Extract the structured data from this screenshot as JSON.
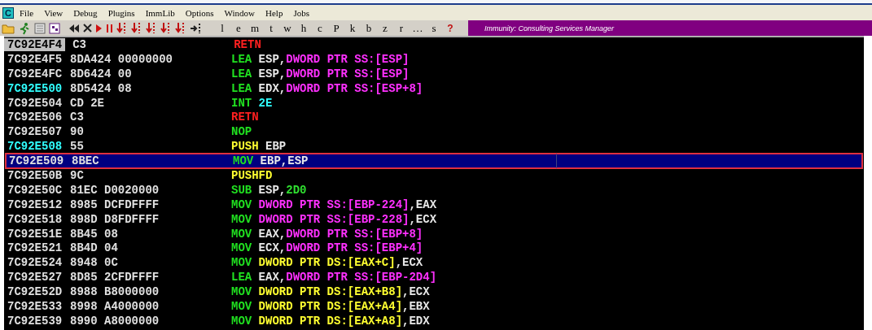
{
  "menu": {
    "app_icon": "C",
    "items": [
      "File",
      "View",
      "Debug",
      "Plugins",
      "ImmLib",
      "Options",
      "Window",
      "Help",
      "Jobs"
    ]
  },
  "toolbar": {
    "buttons": [
      {
        "kind": "open"
      },
      {
        "kind": "run-figure"
      },
      {
        "kind": "window"
      },
      {
        "kind": "threads"
      },
      {
        "kind": "rewind"
      },
      {
        "kind": "close"
      },
      {
        "kind": "play"
      },
      {
        "kind": "pause"
      },
      {
        "kind": "step-into"
      },
      {
        "kind": "step-over"
      },
      {
        "kind": "trace-into"
      },
      {
        "kind": "trace-over"
      },
      {
        "kind": "execute-till-return"
      },
      {
        "kind": "go-to"
      }
    ],
    "letters": [
      "l",
      "e",
      "m",
      "t",
      "w",
      "h",
      "c",
      "P",
      "k",
      "b",
      "z",
      "r",
      "…",
      "s",
      "?"
    ],
    "banner": "Immunity: Consulting Services Manager"
  },
  "rows": [
    {
      "address": "7C92E4F4",
      "current": true,
      "jump_target": false,
      "selected": false,
      "bytes": "C3",
      "instruction": [
        {
          "text": "RETN",
          "kind": "ret"
        }
      ]
    },
    {
      "address": "7C92E4F5",
      "current": false,
      "jump_target": false,
      "selected": false,
      "bytes": "8DA424 00000000",
      "instruction": [
        {
          "text": "LEA",
          "kind": "op"
        },
        {
          "text": " ESP,",
          "kind": "reg"
        },
        {
          "text": "DWORD PTR SS:[ESP]",
          "kind": "stack"
        }
      ]
    },
    {
      "address": "7C92E4FC",
      "current": false,
      "jump_target": false,
      "selected": false,
      "bytes": "8D6424 00",
      "instruction": [
        {
          "text": "LEA",
          "kind": "op"
        },
        {
          "text": " ESP,",
          "kind": "reg"
        },
        {
          "text": "DWORD PTR SS:[ESP]",
          "kind": "stack"
        }
      ]
    },
    {
      "address": "7C92E500",
      "current": false,
      "jump_target": true,
      "selected": false,
      "bytes": "8D5424 08",
      "instruction": [
        {
          "text": "LEA",
          "kind": "op"
        },
        {
          "text": " EDX,",
          "kind": "reg"
        },
        {
          "text": "DWORD PTR SS:[ESP+8]",
          "kind": "stack"
        }
      ]
    },
    {
      "address": "7C92E504",
      "current": false,
      "jump_target": false,
      "selected": false,
      "bytes": "CD 2E",
      "instruction": [
        {
          "text": "INT",
          "kind": "op"
        },
        {
          "text": " 2E",
          "kind": "const"
        }
      ]
    },
    {
      "address": "7C92E506",
      "current": false,
      "jump_target": false,
      "selected": false,
      "bytes": "C3",
      "instruction": [
        {
          "text": "RETN",
          "kind": "ret"
        }
      ]
    },
    {
      "address": "7C92E507",
      "current": false,
      "jump_target": false,
      "selected": false,
      "bytes": "90",
      "instruction": [
        {
          "text": "NOP",
          "kind": "op"
        }
      ]
    },
    {
      "address": "7C92E508",
      "current": false,
      "jump_target": true,
      "selected": false,
      "bytes": "55",
      "instruction": [
        {
          "text": "PUSH",
          "kind": "push"
        },
        {
          "text": " EBP",
          "kind": "reg"
        }
      ]
    },
    {
      "address": "7C92E509",
      "current": false,
      "jump_target": false,
      "selected": true,
      "bytes": "8BEC",
      "instruction": [
        {
          "text": "MOV",
          "kind": "op"
        },
        {
          "text": " EBP,ESP",
          "kind": "reg"
        }
      ]
    },
    {
      "address": "7C92E50B",
      "current": false,
      "jump_target": false,
      "selected": false,
      "bytes": "9C",
      "instruction": [
        {
          "text": "PUSHFD",
          "kind": "push"
        }
      ]
    },
    {
      "address": "7C92E50C",
      "current": false,
      "jump_target": false,
      "selected": false,
      "bytes": "81EC D0020000",
      "instruction": [
        {
          "text": "SUB",
          "kind": "op"
        },
        {
          "text": " ESP,",
          "kind": "reg"
        },
        {
          "text": "2D0",
          "kind": "imm"
        }
      ]
    },
    {
      "address": "7C92E512",
      "current": false,
      "jump_target": false,
      "selected": false,
      "bytes": "8985 DCFDFFFF",
      "instruction": [
        {
          "text": "MOV ",
          "kind": "op"
        },
        {
          "text": "DWORD PTR SS:[EBP-224]",
          "kind": "stack"
        },
        {
          "text": ",EAX",
          "kind": "reg"
        }
      ]
    },
    {
      "address": "7C92E518",
      "current": false,
      "jump_target": false,
      "selected": false,
      "bytes": "898D D8FDFFFF",
      "instruction": [
        {
          "text": "MOV ",
          "kind": "op"
        },
        {
          "text": "DWORD PTR SS:[EBP-228]",
          "kind": "stack"
        },
        {
          "text": ",ECX",
          "kind": "reg"
        }
      ]
    },
    {
      "address": "7C92E51E",
      "current": false,
      "jump_target": false,
      "selected": false,
      "bytes": "8B45 08",
      "instruction": [
        {
          "text": "MOV",
          "kind": "op"
        },
        {
          "text": " EAX,",
          "kind": "reg"
        },
        {
          "text": "DWORD PTR SS:[EBP+8]",
          "kind": "stack"
        }
      ]
    },
    {
      "address": "7C92E521",
      "current": false,
      "jump_target": false,
      "selected": false,
      "bytes": "8B4D 04",
      "instruction": [
        {
          "text": "MOV",
          "kind": "op"
        },
        {
          "text": " ECX,",
          "kind": "reg"
        },
        {
          "text": "DWORD PTR SS:[EBP+4]",
          "kind": "stack"
        }
      ]
    },
    {
      "address": "7C92E524",
      "current": false,
      "jump_target": false,
      "selected": false,
      "bytes": "8948 0C",
      "instruction": [
        {
          "text": "MOV ",
          "kind": "op"
        },
        {
          "text": "DWORD PTR DS:[EAX+C]",
          "kind": "data"
        },
        {
          "text": ",ECX",
          "kind": "reg"
        }
      ]
    },
    {
      "address": "7C92E527",
      "current": false,
      "jump_target": false,
      "selected": false,
      "bytes": "8D85 2CFDFFFF",
      "instruction": [
        {
          "text": "LEA",
          "kind": "op"
        },
        {
          "text": " EAX,",
          "kind": "reg"
        },
        {
          "text": "DWORD PTR SS:[EBP-2D4]",
          "kind": "stack"
        }
      ]
    },
    {
      "address": "7C92E52D",
      "current": false,
      "jump_target": false,
      "selected": false,
      "bytes": "8988 B8000000",
      "instruction": [
        {
          "text": "MOV ",
          "kind": "op"
        },
        {
          "text": "DWORD PTR DS:[EAX+B8]",
          "kind": "data"
        },
        {
          "text": ",ECX",
          "kind": "reg"
        }
      ]
    },
    {
      "address": "7C92E533",
      "current": false,
      "jump_target": false,
      "selected": false,
      "bytes": "8998 A4000000",
      "instruction": [
        {
          "text": "MOV ",
          "kind": "op"
        },
        {
          "text": "DWORD PTR DS:[EAX+A4]",
          "kind": "data"
        },
        {
          "text": ",EBX",
          "kind": "reg"
        }
      ]
    },
    {
      "address": "7C92E539",
      "current": false,
      "jump_target": false,
      "selected": false,
      "bytes": "8990 A8000000",
      "instruction": [
        {
          "text": "MOV ",
          "kind": "op"
        },
        {
          "text": "DWORD PTR DS:[EAX+A8]",
          "kind": "data"
        },
        {
          "text": ",EDX",
          "kind": "reg"
        }
      ]
    }
  ]
}
